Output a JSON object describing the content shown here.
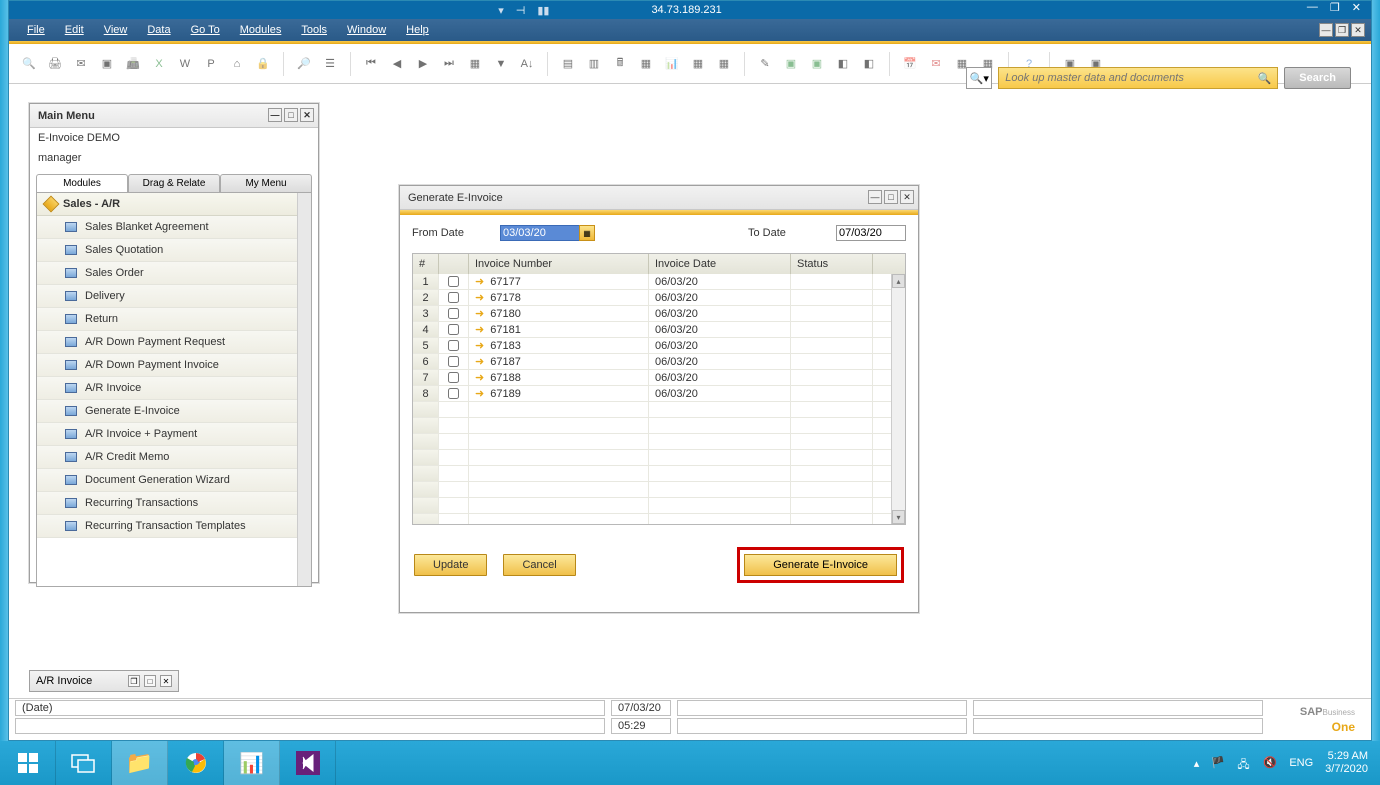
{
  "remote": {
    "ip": "34.73.189.231"
  },
  "menubar": {
    "items": [
      "File",
      "Edit",
      "View",
      "Data",
      "Go To",
      "Modules",
      "Tools",
      "Window",
      "Help"
    ]
  },
  "search": {
    "placeholder": "Look up master data and documents",
    "button": "Search"
  },
  "main_menu": {
    "title": "Main Menu",
    "company": "E-Invoice DEMO",
    "user": "manager",
    "tabs": [
      "Modules",
      "Drag & Relate",
      "My Menu"
    ],
    "active_tab": 0,
    "node": "Sales - A/R",
    "items": [
      "Sales Blanket Agreement",
      "Sales Quotation",
      "Sales Order",
      "Delivery",
      "Return",
      "A/R Down Payment Request",
      "A/R Down Payment Invoice",
      "A/R Invoice",
      "Generate E-Invoice",
      "A/R Invoice + Payment",
      "A/R Credit Memo",
      "Document Generation Wizard",
      "Recurring Transactions",
      "Recurring Transaction Templates"
    ]
  },
  "einvoice": {
    "title": "Generate E-Invoice",
    "from_label": "From Date",
    "to_label": "To Date",
    "from_date": "03/03/20",
    "to_date": "07/03/20",
    "columns": {
      "num": "#",
      "inv": "Invoice Number",
      "date": "Invoice Date",
      "status": "Status"
    },
    "rows": [
      {
        "n": "1",
        "inv": "67177",
        "date": "06/03/20",
        "status": ""
      },
      {
        "n": "2",
        "inv": "67178",
        "date": "06/03/20",
        "status": ""
      },
      {
        "n": "3",
        "inv": "67180",
        "date": "06/03/20",
        "status": ""
      },
      {
        "n": "4",
        "inv": "67181",
        "date": "06/03/20",
        "status": ""
      },
      {
        "n": "5",
        "inv": "67183",
        "date": "06/03/20",
        "status": ""
      },
      {
        "n": "6",
        "inv": "67187",
        "date": "06/03/20",
        "status": ""
      },
      {
        "n": "7",
        "inv": "67188",
        "date": "06/03/20",
        "status": ""
      },
      {
        "n": "8",
        "inv": "67189",
        "date": "06/03/20",
        "status": ""
      }
    ],
    "buttons": {
      "update": "Update",
      "cancel": "Cancel",
      "generate": "Generate E-Invoice"
    }
  },
  "minimized": {
    "ar_invoice": "A/R Invoice"
  },
  "statusbar": {
    "field_label": "(Date)",
    "date": "07/03/20",
    "time": "05:29",
    "brand": "SAP",
    "brand_sub": "Business",
    "brand_one": "One"
  },
  "taskbar": {
    "lang": "ENG",
    "clock_time": "5:29 AM",
    "clock_date": "3/7/2020"
  }
}
